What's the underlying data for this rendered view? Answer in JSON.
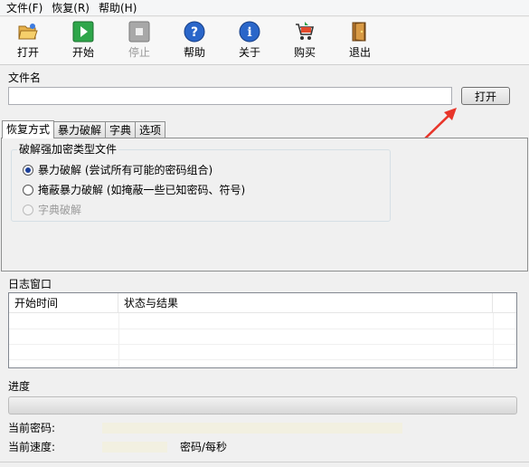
{
  "menu": [
    "文件(F)",
    "恢复(R)",
    "帮助(H)"
  ],
  "toolbar": {
    "open": "打开",
    "start": "开始",
    "stop": "停止",
    "help": "帮助",
    "about": "关于",
    "buy": "购买",
    "exit": "退出"
  },
  "file": {
    "group_label": "文件名",
    "value": "",
    "open_button": "打开"
  },
  "tabs": [
    "恢复方式",
    "暴力破解",
    "字典",
    "选项"
  ],
  "recovery": {
    "group_label": "破解强加密类型文件",
    "options": [
      {
        "label": "暴力破解 (尝试所有可能的密码组合)",
        "checked": true,
        "disabled": false
      },
      {
        "label": "掩蔽暴力破解 (如掩蔽一些已知密码、符号)",
        "checked": false,
        "disabled": false
      },
      {
        "label": "字典破解",
        "checked": false,
        "disabled": true
      }
    ]
  },
  "log": {
    "group_label": "日志窗口",
    "columns": [
      "开始时间",
      "状态与结果"
    ]
  },
  "progress": {
    "group_label": "进度",
    "percent": 0
  },
  "status": {
    "current_password_label": "当前密码:",
    "current_password": "",
    "current_speed_label": "当前速度:",
    "current_speed": "",
    "speed_unit": "密码/每秒"
  },
  "colors": {
    "arrow": "#e8352a",
    "readout_bg": "#f2f0e1",
    "progress_fill": "#06b025"
  }
}
